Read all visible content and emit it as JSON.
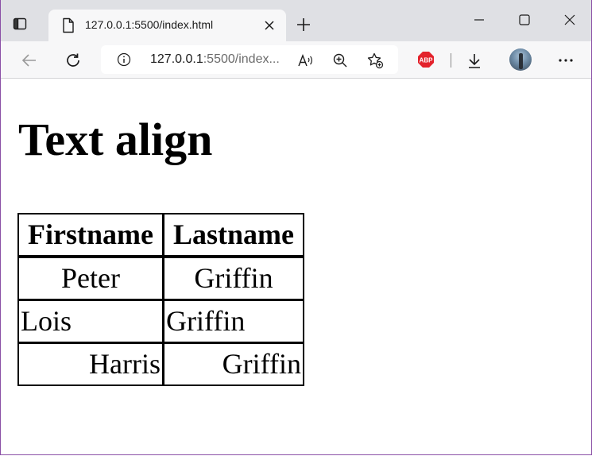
{
  "browser": {
    "tab": {
      "title": "127.0.0.1:5500/index.html"
    },
    "address": {
      "host": "127.0.0.1",
      "rest": ":5500/index..."
    }
  },
  "page": {
    "heading": "Text align",
    "table": {
      "headers": [
        "Firstname",
        "Lastname"
      ],
      "rows": [
        {
          "first": "Peter",
          "last": "Griffin",
          "align": "center"
        },
        {
          "first": "Lois",
          "last": "Griffin",
          "align": "left"
        },
        {
          "first": "Harris",
          "last": "Griffin",
          "align": "right"
        }
      ]
    }
  },
  "colors": {
    "tabstrip": "#dfe0e4",
    "toolbar": "#f7f7f8",
    "window_border": "#8a4fa6",
    "abp_red": "#e3222b"
  },
  "icons": [
    "tab-actions-icon",
    "file-icon",
    "close-icon",
    "plus-icon",
    "minimize-icon",
    "maximize-icon",
    "window-close-icon",
    "back-icon",
    "refresh-icon",
    "info-icon",
    "read-aloud-icon",
    "zoom-icon",
    "favorites-add-icon",
    "adblock-icon",
    "download-icon",
    "more-icon"
  ]
}
